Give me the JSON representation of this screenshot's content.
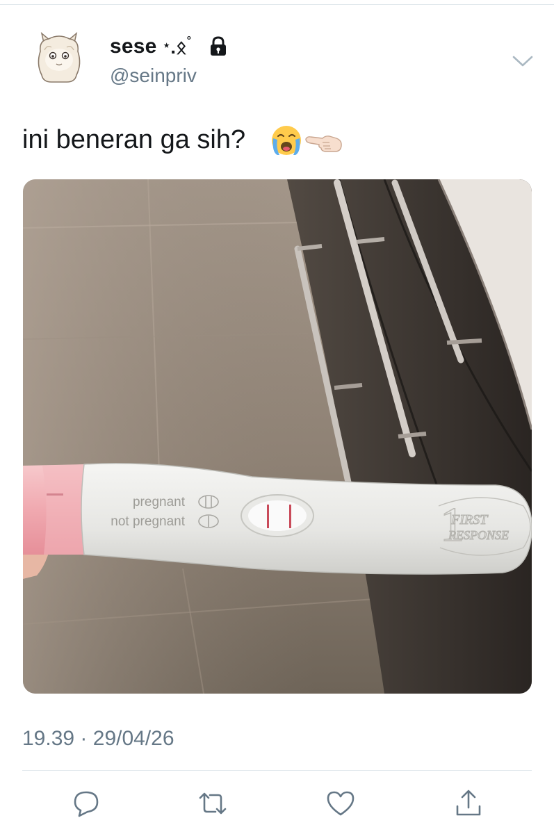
{
  "tweet": {
    "author": {
      "display_name": "sese",
      "name_decoration": "⋆.ೃ࿔*:･",
      "handle": "@seinpriv",
      "protected_icon": "lock-icon",
      "avatar_icon": "alpaca-avatar"
    },
    "menu_icon": "chevron-down-icon",
    "text": "ini beneran ga sih?",
    "emojis": [
      "loudly-crying-face",
      "backhand-index-pointing-left"
    ],
    "media": {
      "kind": "photo",
      "labels": [
        "pregnant",
        "not pregnant"
      ],
      "brand_line1": "FIRST",
      "brand_line2": "RESPONSE",
      "brand_mark": "1"
    },
    "time": "19.39",
    "separator": "·",
    "date": "29/04/26",
    "actions": {
      "reply_icon": "reply-icon",
      "retweet_icon": "retweet-icon",
      "like_icon": "heart-icon",
      "share_icon": "share-icon"
    }
  },
  "colors": {
    "text": "#14171a",
    "secondary": "#657786",
    "divider": "#e1e8ed",
    "action_icon": "#657786"
  }
}
